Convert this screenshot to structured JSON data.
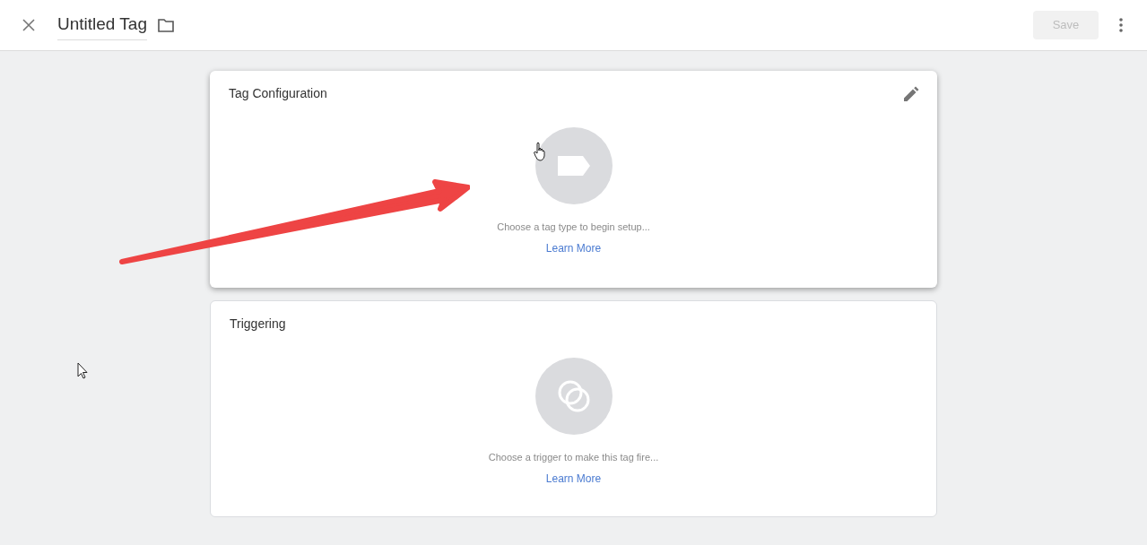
{
  "header": {
    "title": "Untitled Tag",
    "save_button": {
      "label": "Save",
      "disabled": true
    }
  },
  "cards": [
    {
      "title": "Tag Configuration",
      "kind": "tag",
      "hovered": true,
      "prompt": "Choose a tag type to begin setup...",
      "link": "Learn More"
    },
    {
      "title": "Triggering",
      "kind": "trigger",
      "hovered": false,
      "prompt": "Choose a trigger to make this tag fire...",
      "link": "Learn More"
    }
  ]
}
